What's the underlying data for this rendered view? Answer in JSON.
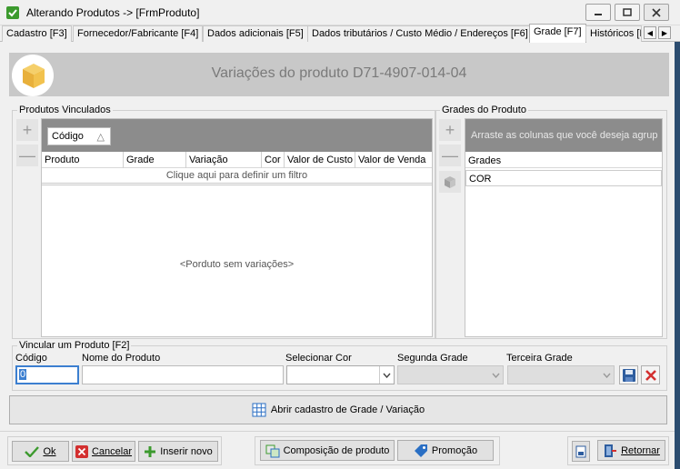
{
  "window": {
    "title": "Alterando Produtos   ->   [FrmProduto]"
  },
  "tabs": [
    {
      "label": "Cadastro [F3]"
    },
    {
      "label": "Fornecedor/Fabricante [F4]"
    },
    {
      "label": "Dados adicionais [F5]"
    },
    {
      "label": "Dados tributários / Custo Médio / Endereços [F6]"
    },
    {
      "label": "Grade [F7]"
    },
    {
      "label": "Históricos [I"
    }
  ],
  "banner": {
    "title": "Variações do produto D71-4907-014-04"
  },
  "linked_products": {
    "group_label": "Produtos Vinculados",
    "group_by_chip": "Código",
    "columns": [
      "Produto",
      "Grade",
      "Variação",
      "Cor",
      "Valor de Custo",
      "Valor de Venda"
    ],
    "filter_hint": "Clique aqui para definir um filtro",
    "empty_text": "<Porduto sem variações>"
  },
  "product_grades": {
    "group_label": "Grades do Produto",
    "group_hint": "Arraste as colunas que você deseja agrup",
    "column": "Grades",
    "rows": [
      "COR"
    ]
  },
  "link_form": {
    "group_label": "Vincular um Produto [F2]",
    "codigo_label": "Código",
    "codigo_value": "0",
    "nome_label": "Nome do Produto",
    "nome_value": "",
    "cor_label": "Selecionar Cor",
    "segunda_label": "Segunda Grade",
    "terceira_label": "Terceira Grade"
  },
  "open_grade_button": "Abrir cadastro de Grade / Variação",
  "footer": {
    "ok": "Ok",
    "cancelar": "Cancelar",
    "inserir": "Inserir novo",
    "composicao": "Composição de produto",
    "promocao": "Promoção",
    "retornar": "Retornar"
  },
  "colors": {
    "accent_green": "#3c9a2e",
    "cancel_red": "#d32f2f",
    "grid_header": "#8c8c8c",
    "banner_bg": "#c8c8c8"
  }
}
